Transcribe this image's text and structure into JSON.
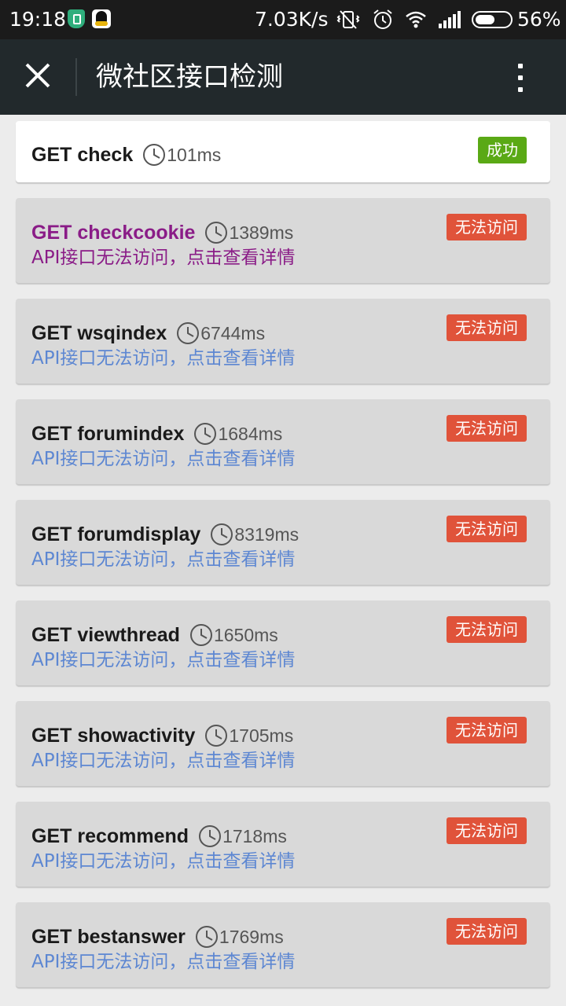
{
  "status_bar": {
    "time": "19:18",
    "net_speed": "7.03K/s",
    "battery_percent": "56%",
    "battery_level": 0.56,
    "icons": [
      "shield-icon",
      "qq-icon",
      "vibrate-off-icon",
      "alarm-icon",
      "wifi-icon",
      "signal-icon",
      "battery-icon"
    ]
  },
  "header": {
    "title": "微社区接口检测",
    "close_icon": "close-icon",
    "menu_icon": "more-vertical-icon"
  },
  "colors": {
    "header_bg": "#22292c",
    "success": "#5aa915",
    "error": "#e0533a",
    "link": "#5d87d2",
    "visited": "#8a1c87"
  },
  "checks": [
    {
      "name": "GET check",
      "duration": "101ms",
      "status": "成功",
      "message": "",
      "state": "success"
    },
    {
      "name": "GET checkcookie",
      "duration": "1389ms",
      "status": "无法访问",
      "message": "API接口无法访问，点击查看详情",
      "state": "visited"
    },
    {
      "name": "GET wsqindex",
      "duration": "6744ms",
      "status": "无法访问",
      "message": "API接口无法访问，点击查看详情",
      "state": "error"
    },
    {
      "name": "GET forumindex",
      "duration": "1684ms",
      "status": "无法访问",
      "message": "API接口无法访问，点击查看详情",
      "state": "error"
    },
    {
      "name": "GET forumdisplay",
      "duration": "8319ms",
      "status": "无法访问",
      "message": "API接口无法访问，点击查看详情",
      "state": "error"
    },
    {
      "name": "GET viewthread",
      "duration": "1650ms",
      "status": "无法访问",
      "message": "API接口无法访问，点击查看详情",
      "state": "error"
    },
    {
      "name": "GET showactivity",
      "duration": "1705ms",
      "status": "无法访问",
      "message": "API接口无法访问，点击查看详情",
      "state": "error"
    },
    {
      "name": "GET recommend",
      "duration": "1718ms",
      "status": "无法访问",
      "message": "API接口无法访问，点击查看详情",
      "state": "error"
    },
    {
      "name": "GET bestanswer",
      "duration": "1769ms",
      "status": "无法访问",
      "message": "API接口无法访问，点击查看详情",
      "state": "error"
    }
  ]
}
